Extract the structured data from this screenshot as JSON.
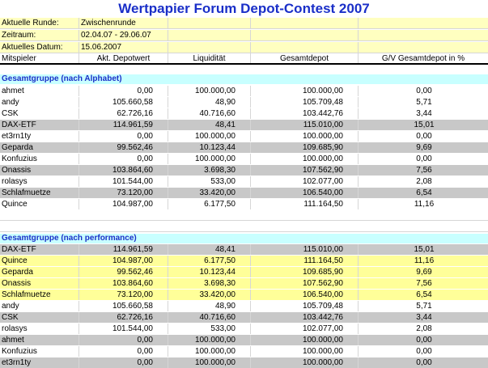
{
  "title": "Wertpapier Forum Depot-Contest 2007",
  "info": [
    {
      "label": "Aktuelle Runde:",
      "value": "Zwischenrunde"
    },
    {
      "label": "Zeitraum:",
      "value": "02.04.07 - 29.06.07"
    },
    {
      "label": "Aktuelles Datum:",
      "value": "15.06.2007"
    }
  ],
  "headers": [
    "Mitspieler",
    "Akt. Depotwert",
    "Liquidität",
    "Gesamtdepot",
    "G/V Gesamtdepot in %"
  ],
  "section1": {
    "title": "Gesamtgruppe (nach Alphabet)",
    "rows": [
      {
        "cells": [
          "ahmet",
          "0,00",
          "100.000,00",
          "100.000,00",
          "0,00"
        ],
        "bg": "w"
      },
      {
        "cells": [
          "andy",
          "105.660,58",
          "48,90",
          "105.709,48",
          "5,71"
        ],
        "bg": "w"
      },
      {
        "cells": [
          "CSK",
          "62.726,16",
          "40.716,60",
          "103.442,76",
          "3,44"
        ],
        "bg": "w"
      },
      {
        "cells": [
          "DAX-ETF",
          "114.961,59",
          "48,41",
          "115.010,00",
          "15,01"
        ],
        "bg": "g"
      },
      {
        "cells": [
          "et3rn1ty",
          "0,00",
          "100.000,00",
          "100.000,00",
          "0,00"
        ],
        "bg": "w"
      },
      {
        "cells": [
          "Geparda",
          "99.562,46",
          "10.123,44",
          "109.685,90",
          "9,69"
        ],
        "bg": "g"
      },
      {
        "cells": [
          "Konfuzius",
          "0,00",
          "100.000,00",
          "100.000,00",
          "0,00"
        ],
        "bg": "w"
      },
      {
        "cells": [
          "Onassis",
          "103.864,60",
          "3.698,30",
          "107.562,90",
          "7,56"
        ],
        "bg": "g"
      },
      {
        "cells": [
          "rolasys",
          "101.544,00",
          "533,00",
          "102.077,00",
          "2,08"
        ],
        "bg": "w"
      },
      {
        "cells": [
          "Schlafmuetze",
          "73.120,00",
          "33.420,00",
          "106.540,00",
          "6,54"
        ],
        "bg": "g"
      },
      {
        "cells": [
          "Quince",
          "104.987,00",
          "6.177,50",
          "111.164,50",
          "11,16"
        ],
        "bg": "w"
      }
    ]
  },
  "section2": {
    "title": "Gesamtgruppe (nach performance)",
    "rows": [
      {
        "cells": [
          "DAX-ETF",
          "114.961,59",
          "48,41",
          "115.010,00",
          "15,01"
        ],
        "bg": "g"
      },
      {
        "cells": [
          "Quince",
          "104.987,00",
          "6.177,50",
          "111.164,50",
          "11,16"
        ],
        "bg": "y"
      },
      {
        "cells": [
          "Geparda",
          "99.562,46",
          "10.123,44",
          "109.685,90",
          "9,69"
        ],
        "bg": "y"
      },
      {
        "cells": [
          "Onassis",
          "103.864,60",
          "3.698,30",
          "107.562,90",
          "7,56"
        ],
        "bg": "y"
      },
      {
        "cells": [
          "Schlafmuetze",
          "73.120,00",
          "33.420,00",
          "106.540,00",
          "6,54"
        ],
        "bg": "y"
      },
      {
        "cells": [
          "andy",
          "105.660,58",
          "48,90",
          "105.709,48",
          "5,71"
        ],
        "bg": "w"
      },
      {
        "cells": [
          "CSK",
          "62.726,16",
          "40.716,60",
          "103.442,76",
          "3,44"
        ],
        "bg": "g"
      },
      {
        "cells": [
          "rolasys",
          "101.544,00",
          "533,00",
          "102.077,00",
          "2,08"
        ],
        "bg": "w"
      },
      {
        "cells": [
          "ahmet",
          "0,00",
          "100.000,00",
          "100.000,00",
          "0,00"
        ],
        "bg": "g"
      },
      {
        "cells": [
          "Konfuzius",
          "0,00",
          "100.000,00",
          "100.000,00",
          "0,00"
        ],
        "bg": "w"
      },
      {
        "cells": [
          "et3rn1ty",
          "0,00",
          "100.000,00",
          "100.000,00",
          "0,00"
        ],
        "bg": "g"
      }
    ]
  }
}
